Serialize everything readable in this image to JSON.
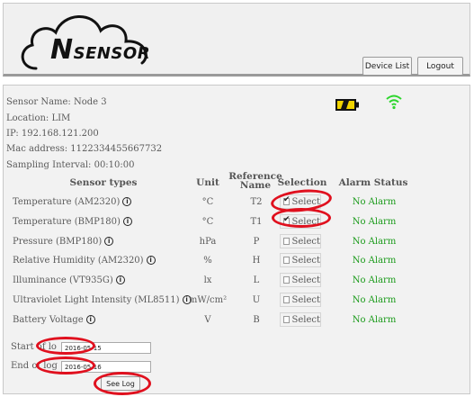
{
  "brand": {
    "logo_text_big": "N",
    "logo_text_rest": "SENSOR"
  },
  "header": {
    "device_list_label": "Device List",
    "logout_label": "Logout"
  },
  "node": {
    "sensor_name": "Sensor Name: Node 3",
    "location": "Location: LIM",
    "ip": "IP: 192.168.121.200",
    "mac": "Mac address: 1122334455667732",
    "sampling": "Sampling Interval: 00:10:00"
  },
  "status_icons": {
    "battery": "battery-icon",
    "wifi": "wifi-icon",
    "battery_color": "#f1d400",
    "wifi_color": "#2ed62e"
  },
  "table": {
    "headers": {
      "type": "Sensor types",
      "unit": "Unit",
      "ref_line1": "Reference",
      "ref_line2": "Name",
      "selection": "Selection",
      "alarm": "Alarm Status"
    },
    "rows": [
      {
        "type": "Temperature (AM2320)",
        "unit": "°C",
        "ref": "T2",
        "select": "Select",
        "checked": true,
        "alarm": "No Alarm"
      },
      {
        "type": "Temperature (BMP180)",
        "unit": "°C",
        "ref": "T1",
        "select": "Select",
        "checked": true,
        "alarm": "No Alarm"
      },
      {
        "type": "Pressure (BMP180)",
        "unit": "hPa",
        "ref": "P",
        "select": "Select",
        "checked": false,
        "alarm": "No Alarm"
      },
      {
        "type": "Relative Humidity (AM2320)",
        "unit": "%",
        "ref": "H",
        "select": "Select",
        "checked": false,
        "alarm": "No Alarm"
      },
      {
        "type": "Illuminance (VT935G)",
        "unit": "lx",
        "ref": "L",
        "select": "Select",
        "checked": false,
        "alarm": "No Alarm"
      },
      {
        "type": "Ultraviolet Light Intensity (ML8511)",
        "unit": "mW/cm²",
        "ref": "U",
        "select": "Select",
        "checked": false,
        "alarm": "No Alarm"
      },
      {
        "type": "Battery Voltage",
        "unit": "V",
        "ref": "B",
        "select": "Select",
        "checked": false,
        "alarm": "No Alarm"
      }
    ]
  },
  "log": {
    "start_label": "Start of lo",
    "start_value": "2016-05-15",
    "end_label": "End of log",
    "end_value": "2016-05-16",
    "see_log_label": "See Log"
  },
  "colors": {
    "alarm_ok": "#1a9a1a",
    "annotation": "#e0101e"
  }
}
